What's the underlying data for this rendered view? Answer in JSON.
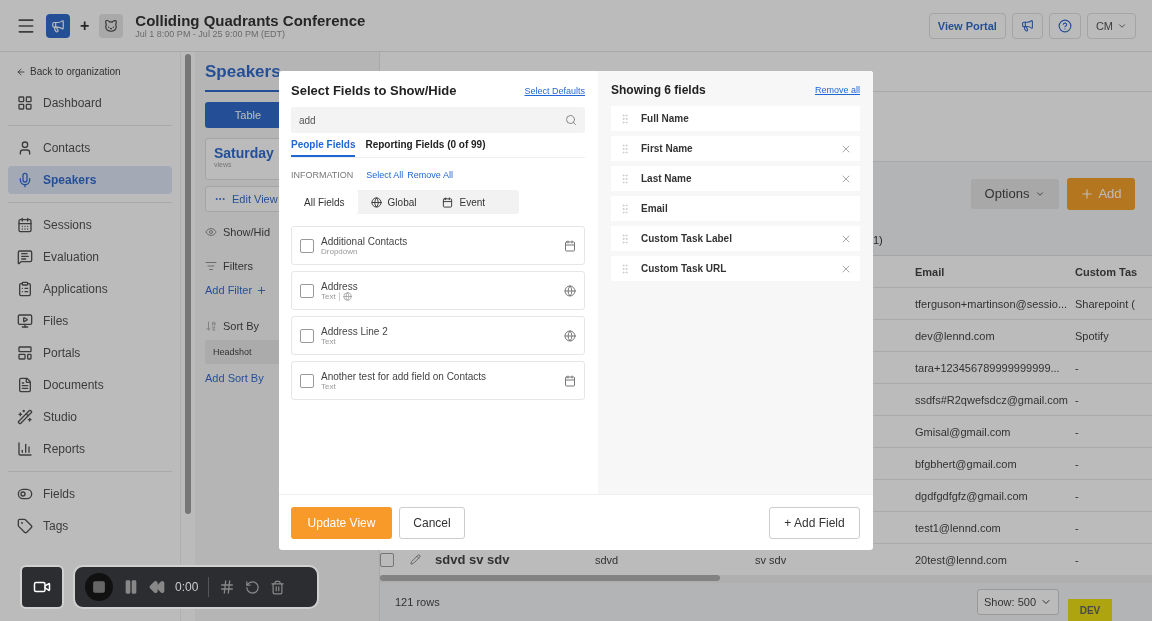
{
  "header": {
    "title": "Colliding Quadrants Conference",
    "join": "+",
    "date": "Jul 1 8:00 PM - Jul 25 9:00 PM (EDT)",
    "portal_button": "View Portal",
    "user": "CM"
  },
  "sidebar": {
    "back": "Back to organization",
    "groups": [
      [
        {
          "label": "Dashboard",
          "kind": "dashboard",
          "selected": false
        }
      ],
      [
        {
          "label": "Contacts",
          "kind": "contacts",
          "selected": false
        },
        {
          "label": "Speakers",
          "kind": "speakers",
          "selected": true
        }
      ],
      [
        {
          "label": "Sessions",
          "kind": "sessions",
          "selected": false
        },
        {
          "label": "Evaluation",
          "kind": "evaluation",
          "selected": false
        },
        {
          "label": "Applications",
          "kind": "applications",
          "selected": false
        },
        {
          "label": "Files",
          "kind": "files",
          "selected": false
        },
        {
          "label": "Portals",
          "kind": "portals",
          "selected": false
        },
        {
          "label": "Documents",
          "kind": "documents",
          "selected": false
        },
        {
          "label": "Studio",
          "kind": "studio",
          "selected": false
        },
        {
          "label": "Reports",
          "kind": "reports",
          "selected": false
        }
      ],
      [
        {
          "label": "Fields",
          "kind": "fields",
          "selected": false
        },
        {
          "label": "Tags",
          "kind": "tags",
          "selected": false
        }
      ]
    ]
  },
  "views_panel": {
    "tabs": [
      {
        "label": "Speakers",
        "selected": true
      }
    ],
    "mode": "Table",
    "view_name": "Saturday",
    "view_caption": "views",
    "edit_view": "Edit View",
    "show_hide": "Show/Hid",
    "filters": "Filters",
    "add_filter": "Add Filter",
    "sort_by": "Sort By",
    "sort_item": "Headshot",
    "add_sort": "Add Sort By"
  },
  "table": {
    "options": "Options",
    "add": "Add",
    "count": "1)",
    "columns": [
      "Email",
      "Custom Tas"
    ],
    "rows": [
      {
        "email": "tferguson+martinson@sessio...",
        "custom": "Sharepoint ("
      },
      {
        "email": "dev@lennd.com",
        "custom": "Spotify"
      },
      {
        "email": "tara+123456789999999999...",
        "custom": "-"
      },
      {
        "email": "ssdfs#R2qwefsdcz@gmail.com",
        "custom": "-"
      },
      {
        "email": "Gmisal@gmail.com",
        "custom": "-"
      },
      {
        "email": "bfgbhert@gmail.com",
        "custom": "-"
      },
      {
        "email": "dgdfgdfgfz@gmail.com",
        "custom": "-"
      },
      {
        "email": "test1@lennd.com",
        "custom": "-"
      }
    ],
    "last_row": {
      "checked": false,
      "name": "sdvd sv sdv",
      "column_3": "sdvd",
      "column_4": "sv sdv",
      "email": "20test@lennd.com",
      "custom": "-"
    },
    "row_count": "121 rows",
    "page_size": "Show: 500",
    "env": "DEV"
  },
  "recorder": {
    "time": "0:00"
  },
  "modal": {
    "title": "Select Fields to Show/Hide",
    "select_defaults": "Select Defaults",
    "search": {
      "value": "add"
    },
    "tabs": [
      {
        "label": "People Fields",
        "selected": true
      },
      {
        "label": "Reporting Fields (0 of 99)",
        "selected": false
      }
    ],
    "section": "INFORMATION",
    "select_all": "Select All",
    "remove_all": "Remove All",
    "scopes": [
      {
        "label": "All Fields",
        "kind": "all",
        "selected": true
      },
      {
        "label": "Global",
        "kind": "global",
        "selected": false
      },
      {
        "label": "Event",
        "kind": "event",
        "selected": false
      }
    ],
    "fields": [
      {
        "name": "Additional Contacts",
        "type": "Dropdown",
        "kind": "event",
        "shared": false,
        "checked": false
      },
      {
        "name": "Address",
        "type": "Text",
        "kind": "global",
        "shared": true,
        "checked": false
      },
      {
        "name": "Address Line 2",
        "type": "Text",
        "kind": "global",
        "shared": false,
        "checked": false
      },
      {
        "name": "Another test for add field on Contacts",
        "type": "Text",
        "kind": "event",
        "shared": false,
        "checked": false
      }
    ],
    "showing": {
      "title": "Showing 6 fields",
      "remove_all": "Remove all",
      "items": [
        {
          "label": "Full Name",
          "removable": false
        },
        {
          "label": "First Name",
          "removable": true
        },
        {
          "label": "Last Name",
          "removable": true
        },
        {
          "label": "Email",
          "removable": false
        },
        {
          "label": "Custom Task Label",
          "removable": true
        },
        {
          "label": "Custom Task URL",
          "removable": true
        }
      ]
    },
    "update": "Update View",
    "cancel": "Cancel",
    "add_field": "+ Add Field"
  }
}
